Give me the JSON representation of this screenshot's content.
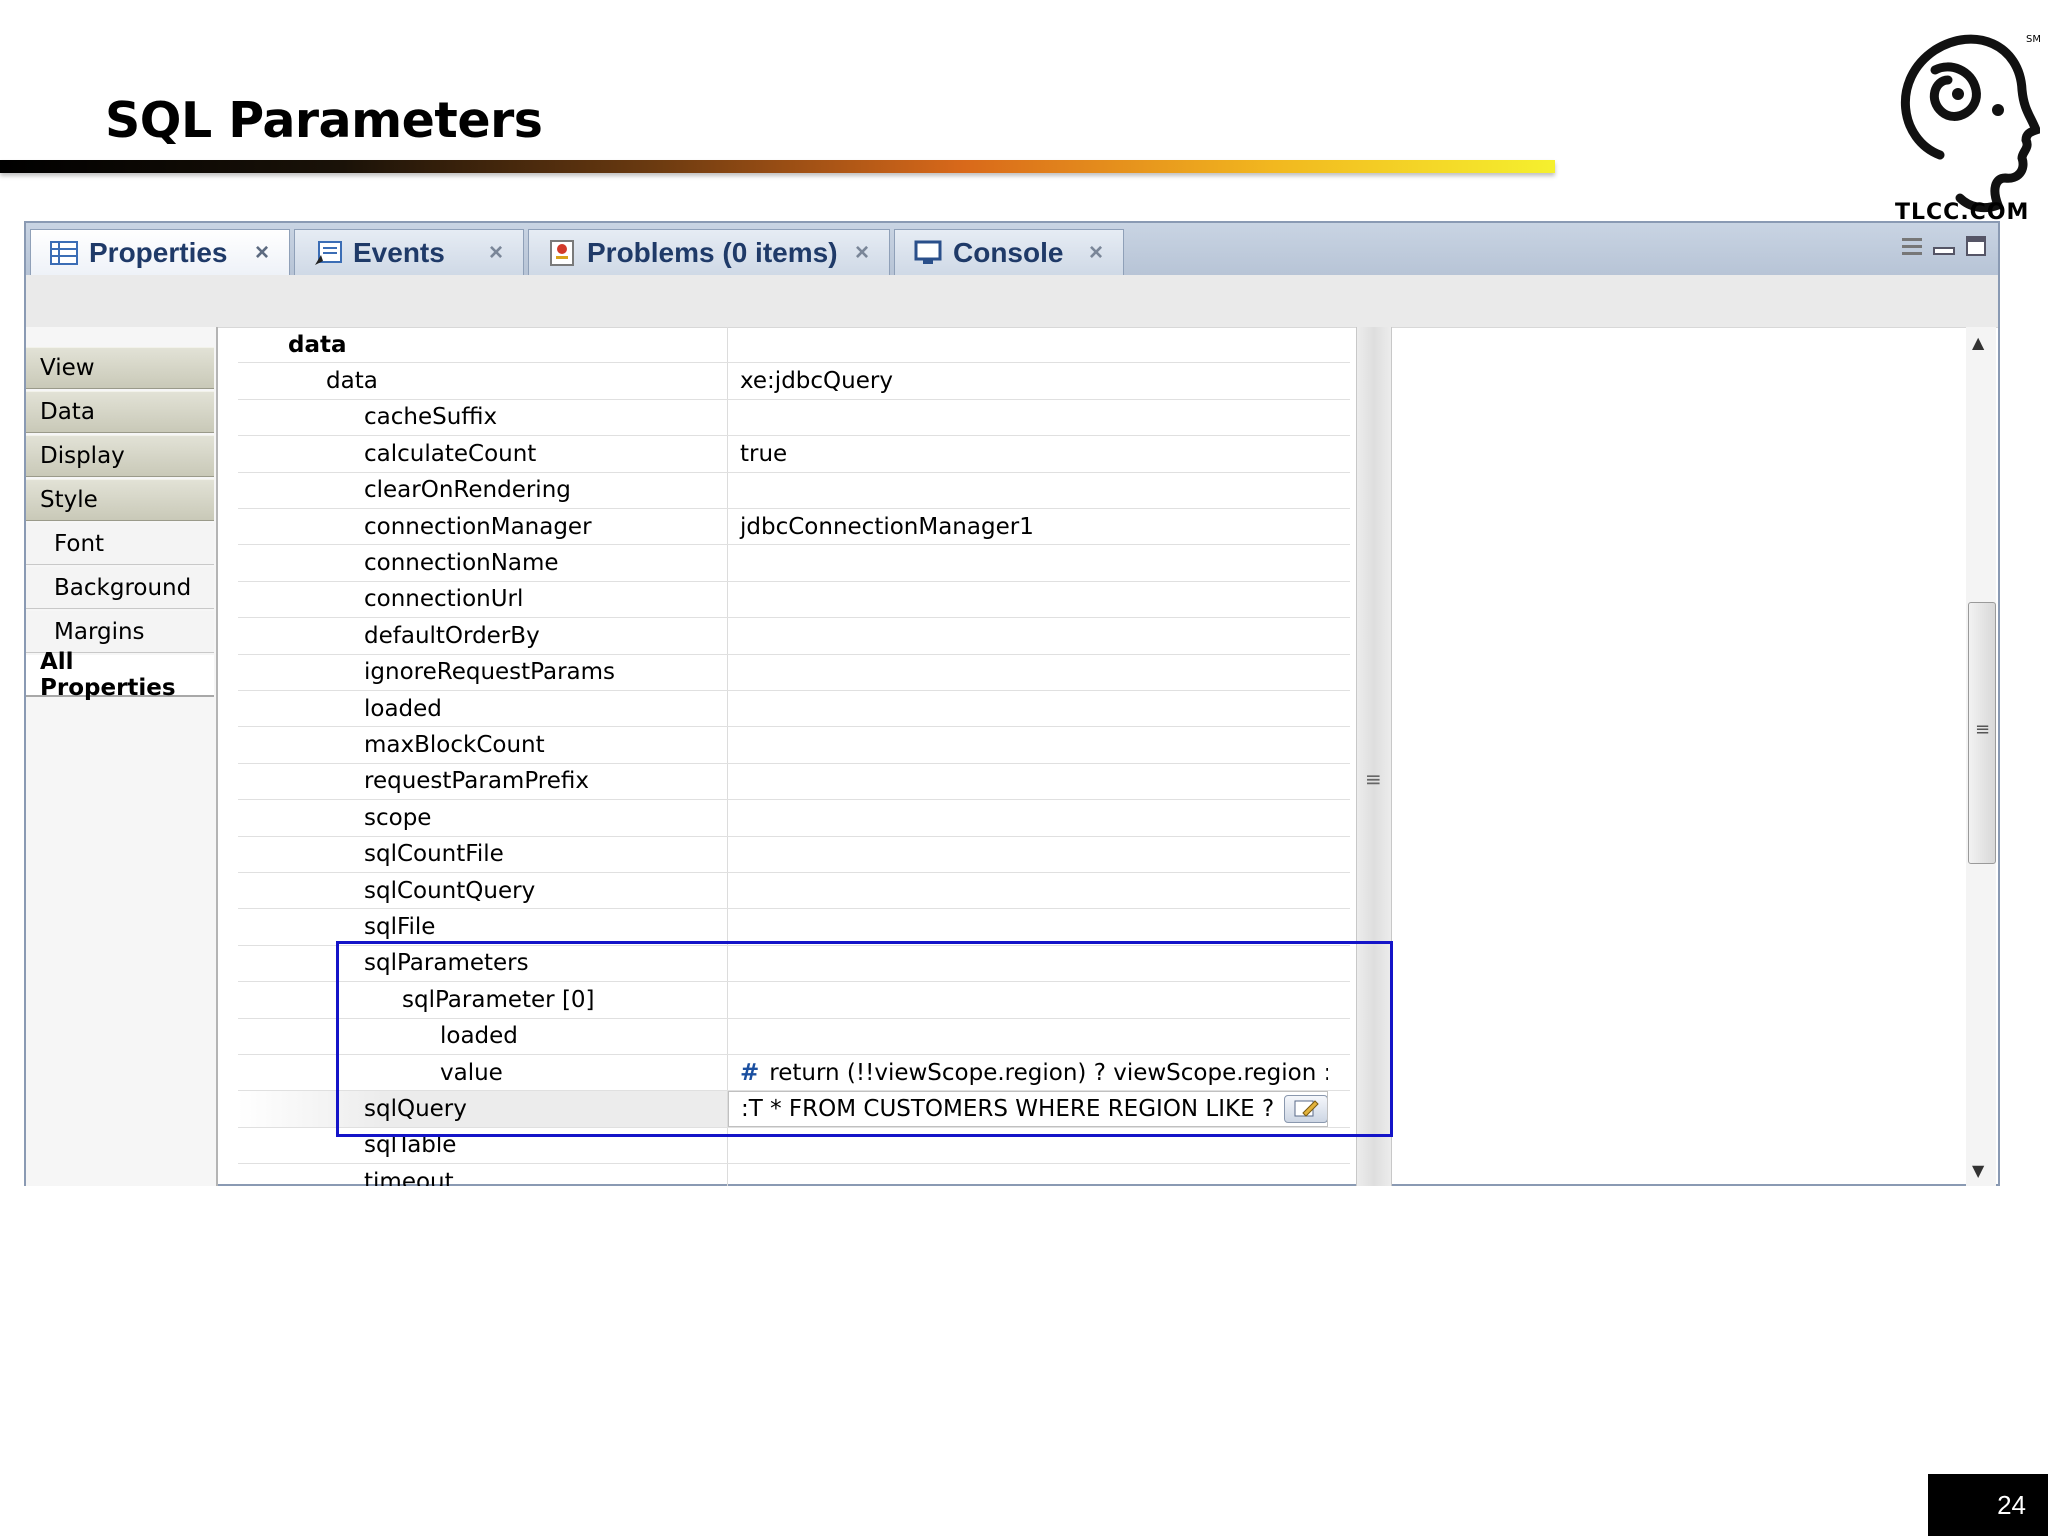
{
  "slide": {
    "title": "SQL Parameters",
    "logo_text": "TLCC.COM",
    "page_number": "24"
  },
  "tabs": [
    {
      "label": "Properties",
      "icon": "properties-icon",
      "active": true
    },
    {
      "label": "Events",
      "icon": "events-icon",
      "active": false
    },
    {
      "label": "Problems (0 items)",
      "icon": "problems-icon",
      "active": false
    },
    {
      "label": "Console",
      "icon": "console-icon",
      "active": false
    }
  ],
  "tab_close_glyph": "×",
  "nav": {
    "items": [
      {
        "label": "View",
        "kind": "group"
      },
      {
        "label": "Data",
        "kind": "group"
      },
      {
        "label": "Display",
        "kind": "group"
      },
      {
        "label": "Style",
        "kind": "group"
      },
      {
        "label": "Font",
        "kind": "sub"
      },
      {
        "label": "Background",
        "kind": "sub"
      },
      {
        "label": "Margins",
        "kind": "sub"
      },
      {
        "label": "All Properties",
        "kind": "selected"
      }
    ]
  },
  "properties": [
    {
      "name": "data",
      "value": "",
      "indent": 0
    },
    {
      "name": "data",
      "value": "xe:jdbcQuery",
      "indent": 1
    },
    {
      "name": "cacheSuffix",
      "value": "",
      "indent": 2
    },
    {
      "name": "calculateCount",
      "value": "true",
      "indent": 2
    },
    {
      "name": "clearOnRendering",
      "value": "",
      "indent": 2
    },
    {
      "name": "connectionManager",
      "value": "jdbcConnectionManager1",
      "indent": 2
    },
    {
      "name": "connectionName",
      "value": "",
      "indent": 2
    },
    {
      "name": "connectionUrl",
      "value": "",
      "indent": 2
    },
    {
      "name": "defaultOrderBy",
      "value": "",
      "indent": 2
    },
    {
      "name": "ignoreRequestParams",
      "value": "",
      "indent": 2
    },
    {
      "name": "loaded",
      "value": "",
      "indent": 2
    },
    {
      "name": "maxBlockCount",
      "value": "",
      "indent": 2
    },
    {
      "name": "requestParamPrefix",
      "value": "",
      "indent": 2
    },
    {
      "name": "scope",
      "value": "",
      "indent": 2
    },
    {
      "name": "sqlCountFile",
      "value": "",
      "indent": 2
    },
    {
      "name": "sqlCountQuery",
      "value": "",
      "indent": 2
    },
    {
      "name": "sqlFile",
      "value": "",
      "indent": 2
    },
    {
      "name": "sqlParameters",
      "value": "",
      "indent": 2
    },
    {
      "name": "sqlParameter [0]",
      "value": "",
      "indent": 3
    },
    {
      "name": "loaded",
      "value": "",
      "indent": 4
    },
    {
      "name": "value",
      "value": "return (!!viewScope.region) ? viewScope.region : \"%\";",
      "indent": 4,
      "prefix": "#"
    },
    {
      "name": "sqlQuery",
      "value": ":T * FROM CUSTOMERS WHERE REGION LIKE ?",
      "indent": 2,
      "editing": true
    },
    {
      "name": "sqlTable",
      "value": "",
      "indent": 2
    },
    {
      "name": "timeout",
      "value": "",
      "indent": 2
    }
  ],
  "colors": {
    "highlight_box": "#1414c8",
    "tab_text": "#1f3a68",
    "tabbar": "#c9d4e3"
  }
}
